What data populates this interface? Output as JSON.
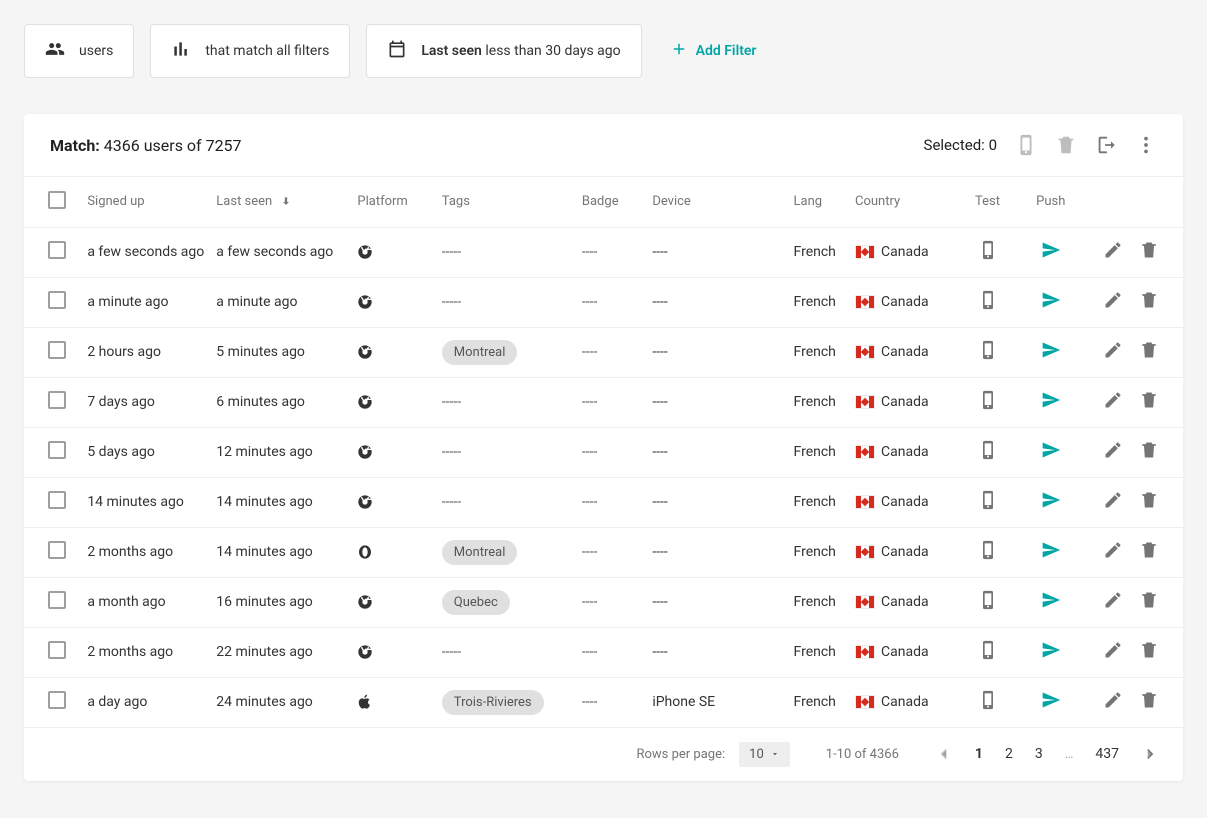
{
  "filters": {
    "users_label": "users",
    "match_mode_label": "that match all filters",
    "active_filter_prefix": "Last seen",
    "active_filter_suffix": "less than 30 days ago",
    "add_filter_label": "Add Filter"
  },
  "header": {
    "match_prefix": "Match:",
    "match_value": "4366 users of 7257",
    "selected_prefix": "Selected:",
    "selected_count": "0"
  },
  "columns": {
    "signed_up": "Signed up",
    "last_seen": "Last seen",
    "platform": "Platform",
    "tags": "Tags",
    "badge": "Badge",
    "device": "Device",
    "lang": "Lang",
    "country": "Country",
    "test": "Test",
    "push": "Push"
  },
  "rows": [
    {
      "signed_up": "a few seconds ago",
      "last_seen": "a few seconds ago",
      "platform": "chrome",
      "tags": "",
      "badge": "----",
      "device": "----",
      "lang": "French",
      "country": "Canada",
      "tags_display": "-----"
    },
    {
      "signed_up": "a minute ago",
      "last_seen": "a minute ago",
      "platform": "chrome",
      "tags": "",
      "badge": "----",
      "device": "----",
      "lang": "French",
      "country": "Canada",
      "tags_display": "-----"
    },
    {
      "signed_up": "2 hours ago",
      "last_seen": "5 minutes ago",
      "platform": "chrome",
      "tags": "Montreal",
      "badge": "----",
      "device": "----",
      "lang": "French",
      "country": "Canada",
      "tags_display": ""
    },
    {
      "signed_up": "7 days ago",
      "last_seen": "6 minutes ago",
      "platform": "chrome",
      "tags": "",
      "badge": "----",
      "device": "----",
      "lang": "French",
      "country": "Canada",
      "tags_display": "-----"
    },
    {
      "signed_up": "5 days ago",
      "last_seen": "12 minutes ago",
      "platform": "chrome",
      "tags": "",
      "badge": "----",
      "device": "----",
      "lang": "French",
      "country": "Canada",
      "tags_display": "-----"
    },
    {
      "signed_up": "14 minutes ago",
      "last_seen": "14 minutes ago",
      "platform": "chrome",
      "tags": "",
      "badge": "----",
      "device": "----",
      "lang": "French",
      "country": "Canada",
      "tags_display": "-----"
    },
    {
      "signed_up": "2 months ago",
      "last_seen": "14 minutes ago",
      "platform": "opera",
      "tags": "Montreal",
      "badge": "----",
      "device": "----",
      "lang": "French",
      "country": "Canada",
      "tags_display": ""
    },
    {
      "signed_up": "a month ago",
      "last_seen": "16 minutes ago",
      "platform": "chrome",
      "tags": "Quebec",
      "badge": "----",
      "device": "----",
      "lang": "French",
      "country": "Canada",
      "tags_display": ""
    },
    {
      "signed_up": "2 months ago",
      "last_seen": "22 minutes ago",
      "platform": "chrome",
      "tags": "",
      "badge": "----",
      "device": "----",
      "lang": "French",
      "country": "Canada",
      "tags_display": "-----"
    },
    {
      "signed_up": "a day ago",
      "last_seen": "24 minutes ago",
      "platform": "apple",
      "tags": "Trois-Rivieres",
      "badge": "----",
      "device": "iPhone SE",
      "lang": "French",
      "country": "Canada",
      "tags_display": ""
    }
  ],
  "footer": {
    "rows_per_page_label": "Rows per page:",
    "rows_per_page_value": "10",
    "range_text": "1-10 of 4366",
    "pages": [
      "1",
      "2",
      "3"
    ],
    "ellipsis": "…",
    "last_page": "437"
  }
}
